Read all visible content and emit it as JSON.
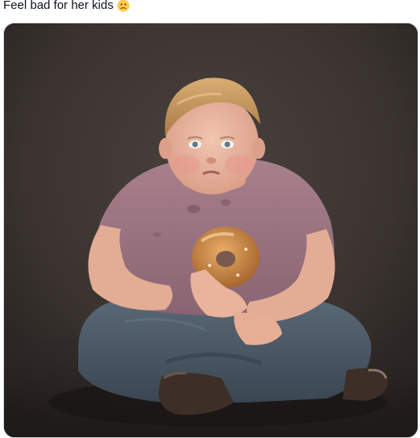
{
  "post": {
    "text": "Feel bad for her kids",
    "emoji": "slightly-frowning-face-emoji"
  },
  "media": {
    "alt": "",
    "type": "photo"
  },
  "colors": {
    "text": "#0f1419",
    "card_border": "#cfd9de",
    "backdrop": "#3b3431",
    "shirt": "#9d7582",
    "jeans": "#4a5764",
    "donut": "#c98a46",
    "skin": "#e9b9a2",
    "hair": "#c99a62"
  }
}
